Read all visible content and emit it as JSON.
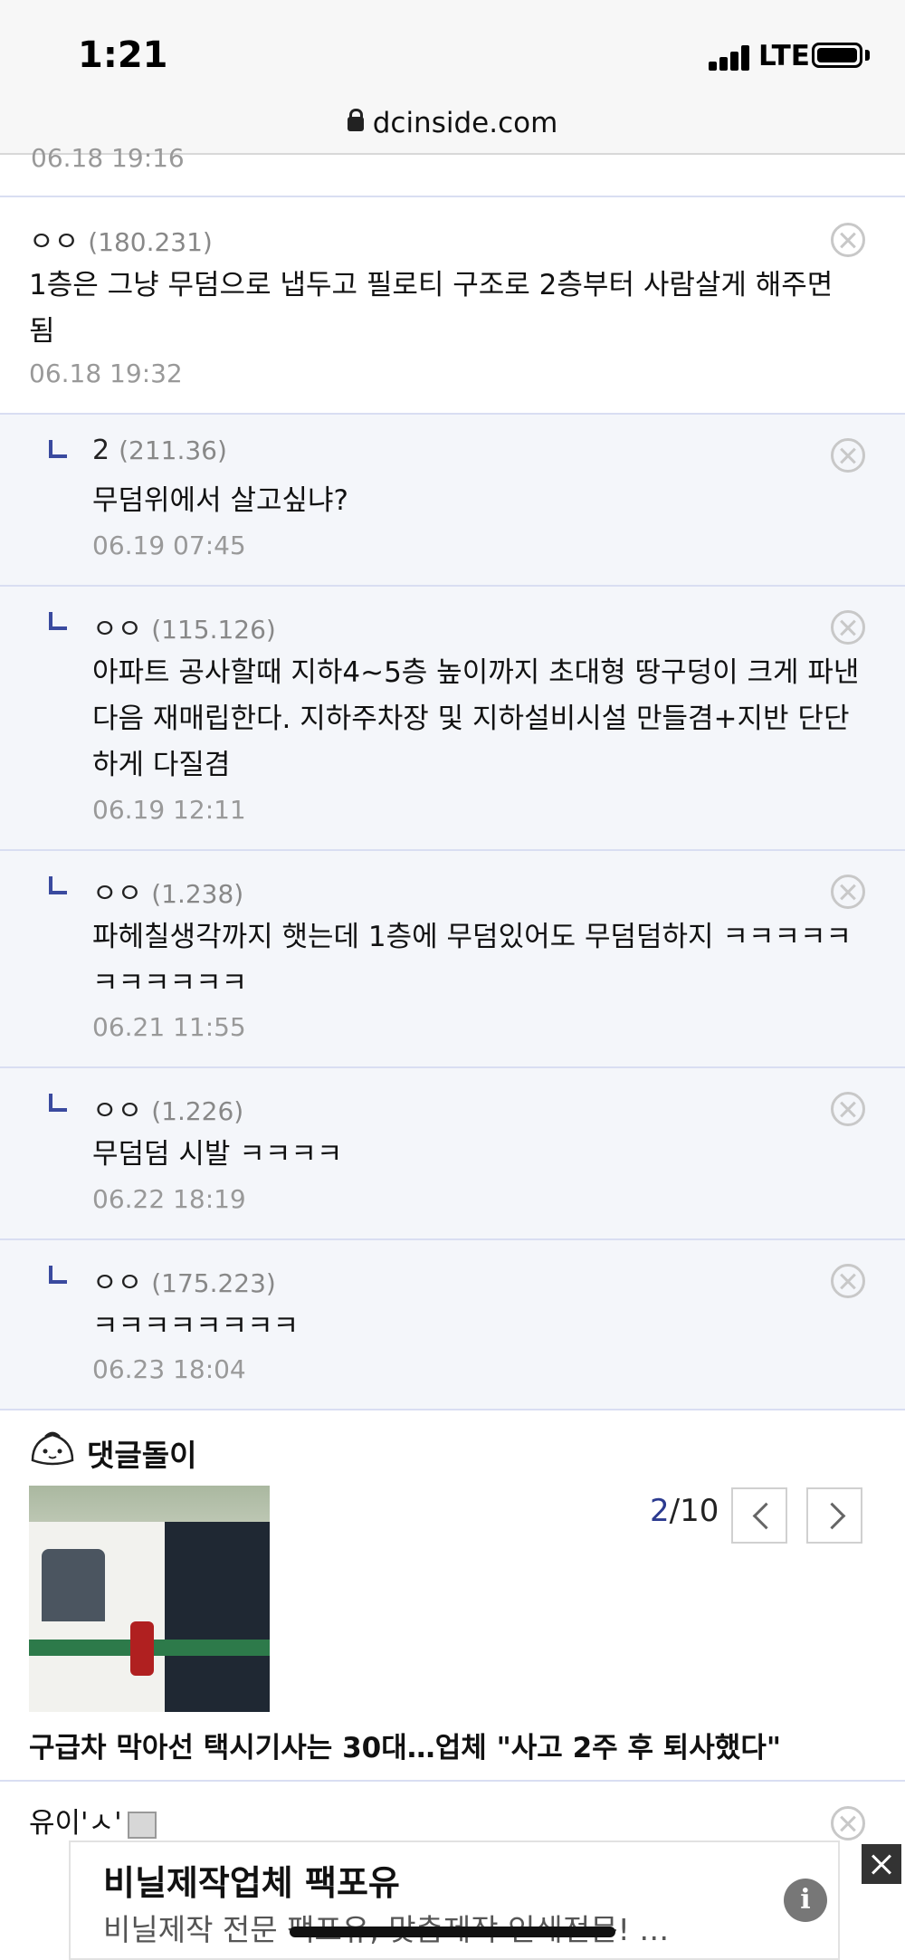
{
  "status_bar": {
    "time": "1:21",
    "network": "LTE"
  },
  "browser": {
    "url": "dcinside.com"
  },
  "partial_comment": {
    "date": "06.18 19:16"
  },
  "comments": [
    {
      "name": "ㅇㅇ",
      "ip": "(180.231)",
      "text": "1층은 그냥 무덤으로 냅두고 필로티 구조로 2층부터 사람살게 해주면 됨",
      "date": "06.18 19:32",
      "reply": false
    },
    {
      "name": "2",
      "ip": "(211.36)",
      "text": "무덤위에서 살고싶냐?",
      "date": "06.19 07:45",
      "reply": true
    },
    {
      "name": "ㅇㅇ",
      "ip": "(115.126)",
      "text": "아파트 공사할때 지하4~5층 높이까지 초대형 땅구덩이 크게 파낸다음 재매립한다. 지하주차장 및 지하설비시설 만들겸+지반 단단하게 다질겸",
      "date": "06.19 12:11",
      "reply": true
    },
    {
      "name": "ㅇㅇ",
      "ip": "(1.238)",
      "text": "파헤칠생각까지 햇는데 1층에 무덤있어도 무덤덤하지 ㅋㅋㅋㅋㅋㅋㅋㅋㅋㅋㅋ",
      "date": "06.21 11:55",
      "reply": true
    },
    {
      "name": "ㅇㅇ",
      "ip": "(1.226)",
      "text": "무덤덤 시발 ㅋㅋㅋㅋ",
      "date": "06.22 18:19",
      "reply": true
    },
    {
      "name": "ㅇㅇ",
      "ip": "(175.223)",
      "text": "ㅋㅋㅋㅋㅋㅋㅋㅋ",
      "date": "06.23 18:04",
      "reply": true
    }
  ],
  "comment_bot": {
    "title": "댓글돌이",
    "counter_current": "2",
    "counter_total": "/10",
    "headline": "구급차 막아선 택시기사는 30대…업체 \"사고 2주 후 퇴사했다\""
  },
  "last_comment": {
    "name": "유이'ㅅ'"
  },
  "ad": {
    "title": "비닐제작업체 팩포유",
    "description": "비닐제작 전문 팩포유, 맞춤제작 인쇄전문! …",
    "info_label": "i"
  }
}
